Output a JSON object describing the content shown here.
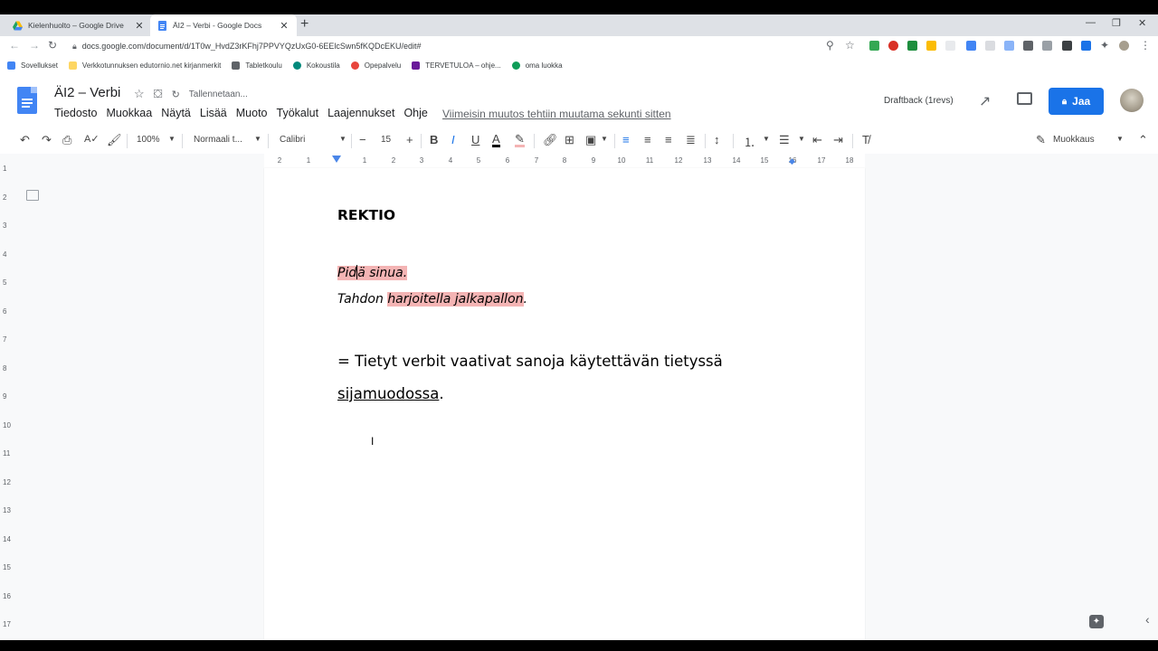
{
  "browser": {
    "tabs": [
      {
        "title": "Kielenhuolto – Google Drive",
        "icon": "google-drive-icon",
        "active": false
      },
      {
        "title": "ÄI2 – Verbi - Google Docs",
        "icon": "google-docs-icon",
        "active": true
      }
    ],
    "new_tab": "+",
    "url": "docs.google.com/document/d/1T0w_HvdZ3rKFhj7PPVYQzUxG0-6EElcSwn5fKQDcEKU/edit#",
    "bookmarks": [
      {
        "label": "Sovellukset",
        "icon": "apps-grid-icon"
      },
      {
        "label": "Verkkotunnuksen edutornio.net kirjanmerkit",
        "icon": "folder-icon"
      },
      {
        "label": "Tabletkoulu",
        "icon": "tablet-icon"
      },
      {
        "label": "Kokoustila",
        "icon": "meet-icon"
      },
      {
        "label": "Opepalvelu",
        "icon": "opepalvelu-icon"
      },
      {
        "label": "TERVETULOA – ohje...",
        "icon": "up-logo-icon"
      },
      {
        "label": "oma luokka",
        "icon": "classroom-icon"
      }
    ]
  },
  "doc_header": {
    "title": "ÄI2 – Verbi",
    "saving": "Tallennetaan...",
    "menu": [
      "Tiedosto",
      "Muokkaa",
      "Näytä",
      "Lisää",
      "Muoto",
      "Työkalut",
      "Laajennukset",
      "Ohje"
    ],
    "last_edit": "Viimeisin muutos tehtiin muutama sekunti sitten",
    "draftback": "Draftback (1revs)",
    "share_label": "Jaa"
  },
  "toolbar": {
    "zoom": "100%",
    "style": "Normaali t...",
    "font": "Calibri",
    "font_size": "15",
    "mode": "Muokkaus"
  },
  "ruler": {
    "ticks": [
      "2",
      "1",
      "1",
      "2",
      "3",
      "4",
      "5",
      "6",
      "7",
      "8",
      "9",
      "10",
      "11",
      "12",
      "13",
      "14",
      "15",
      "16",
      "17",
      "18"
    ],
    "vertical_ticks": [
      "1",
      "2",
      "3",
      "4",
      "5",
      "6",
      "7",
      "8",
      "9",
      "10",
      "11",
      "12",
      "13",
      "14",
      "15",
      "16",
      "17"
    ]
  },
  "document": {
    "heading": "REKTIO",
    "example1_a": "Pid",
    "example1_b": "ä sinua.",
    "example2_prefix": "Tahdon ",
    "example2_highlight": "harjoitella jalkapallon",
    "example2_suffix": ".",
    "definition_line1": "= Tietyt verbit vaativat sanoja käytettävän tietyssä",
    "definition_line2_underlined": "sijamuodossa",
    "definition_line2_suffix": "."
  }
}
